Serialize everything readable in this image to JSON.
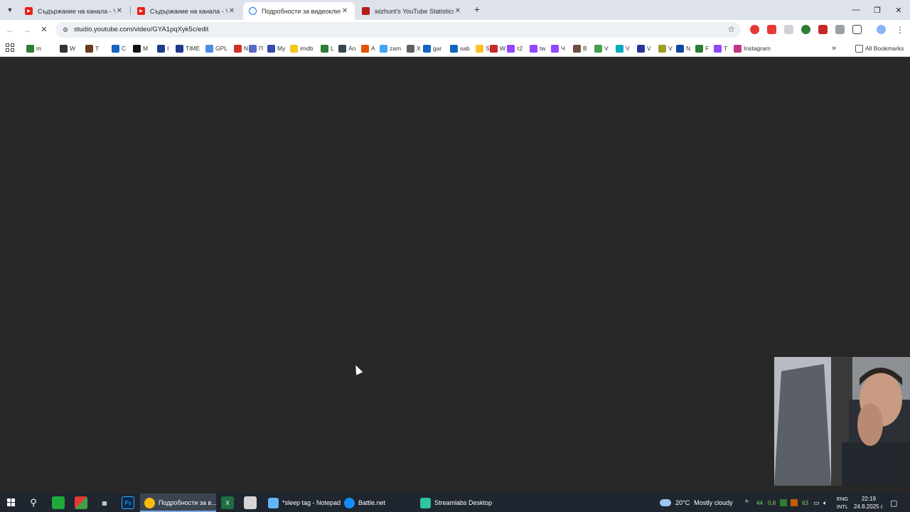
{
  "browser": {
    "tabs": [
      {
        "title": "Съдържание на канала - YouT",
        "favicon": "youtube-studio-icon",
        "color": "#e62117",
        "active": false
      },
      {
        "title": "Съдържание на канала - YouT",
        "favicon": "youtube-studio-icon",
        "color": "#e62117",
        "active": false
      },
      {
        "title": "Подробности за видеоклипа",
        "favicon": "loading-spinner-icon",
        "color": "#1a73e8",
        "active": true
      },
      {
        "title": "wizhunt's YouTube Statistics - S",
        "favicon": "socialblade-icon",
        "color": "#b71c1c",
        "active": false
      }
    ],
    "tab_close_glyph": "✕",
    "new_tab_glyph": "+",
    "window_controls": {
      "minimize": "—",
      "restore": "❐",
      "close": "✕"
    },
    "url": "studio.youtube.com/video/GYA1pqXyk5c/edit",
    "nav": {
      "back": "←",
      "forward": "→",
      "stop": "✕"
    },
    "bookmarks": [
      {
        "label": "m",
        "color": "#2e7d32"
      },
      {
        "label": "W",
        "color": "#333333"
      },
      {
        "label": "T",
        "color": "#6d3a1f"
      },
      {
        "label": "C",
        "color": "#1565c0"
      },
      {
        "label": "M",
        "color": "#111111"
      },
      {
        "label": "I",
        "color": "#1e3a8a"
      },
      {
        "label": "TIME",
        "color": "#1e3a8a"
      },
      {
        "label": "GPL",
        "color": "#4a90e2"
      },
      {
        "label": "N",
        "color": "#d32f2f"
      },
      {
        "label": "П",
        "color": "#5c6bc0"
      },
      {
        "label": "My",
        "color": "#3949ab"
      },
      {
        "label": "imdb",
        "color": "#f5c518"
      },
      {
        "label": "L",
        "color": "#2e7d32"
      },
      {
        "label": "An",
        "color": "#37474f"
      },
      {
        "label": "A",
        "color": "#e65100"
      },
      {
        "label": "zam",
        "color": "#42a5f5"
      },
      {
        "label": "X",
        "color": "#616161"
      },
      {
        "label": "gar",
        "color": "#1565c0"
      },
      {
        "label": "sab",
        "color": "#1565c0"
      },
      {
        "label": "S",
        "color": "#fbc02d"
      },
      {
        "label": "W",
        "color": "#c62828"
      },
      {
        "label": "τ2",
        "color": "#9146ff"
      },
      {
        "label": "tw",
        "color": "#9146ff"
      },
      {
        "label": "Ч",
        "color": "#9146ff"
      },
      {
        "label": "B",
        "color": "#6d4c41"
      },
      {
        "label": "V",
        "color": "#43a047"
      },
      {
        "label": "V",
        "color": "#00acc1"
      },
      {
        "label": "V",
        "color": "#283593"
      },
      {
        "label": "V",
        "color": "#9e9d24"
      },
      {
        "label": "N",
        "color": "#0d47a1"
      },
      {
        "label": "F",
        "color": "#2e7d32"
      },
      {
        "label": "T",
        "color": "#9146ff"
      },
      {
        "label": "Instagram",
        "color": "#c13584"
      }
    ],
    "overflow_glyph": "»",
    "all_bookmarks_label": "All Bookmarks"
  },
  "taskbar": {
    "apps": [
      {
        "label": "Подробности за в...",
        "icon": "chrome-icon",
        "color": "#4caf50",
        "active": true
      },
      {
        "label": "*sleep tag - Notepad",
        "icon": "notepad-icon",
        "color": "#64b5f6",
        "active": false
      },
      {
        "label": "Battle.net",
        "icon": "battlenet-icon",
        "color": "#148eff",
        "active": false
      },
      {
        "label": "Streamlabs Desktop",
        "icon": "streamlabs-icon",
        "color": "#31c3a2",
        "active": false
      }
    ],
    "weather": {
      "temp": "20°C",
      "condition": "Mostly cloudy"
    },
    "tray_numbers": [
      "44",
      "0,8",
      "63"
    ],
    "language": {
      "line1": "ENG",
      "line2": "INTL"
    },
    "clock": {
      "time": "22:19",
      "date": "24.8.2025 г."
    }
  }
}
